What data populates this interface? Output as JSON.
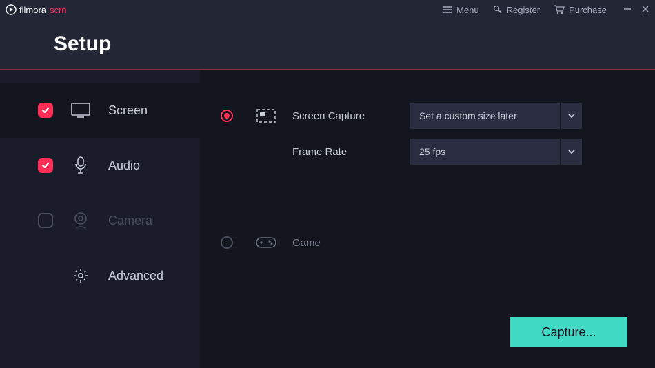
{
  "app": {
    "brand_primary": "filmora",
    "brand_accent": "scrn"
  },
  "titlebar": {
    "menu": "Menu",
    "register": "Register",
    "purchase": "Purchase"
  },
  "header": {
    "title": "Setup"
  },
  "sidebar": {
    "items": [
      {
        "label": "Screen",
        "checked": true,
        "active": true
      },
      {
        "label": "Audio",
        "checked": true
      },
      {
        "label": "Camera",
        "checked": false,
        "disabled": true
      },
      {
        "label": "Advanced"
      }
    ]
  },
  "content": {
    "screen_capture": {
      "label": "Screen Capture",
      "value": "Set a custom size later"
    },
    "frame_rate": {
      "label": "Frame Rate",
      "value": "25 fps"
    },
    "game": {
      "label": "Game"
    },
    "capture_button": "Capture..."
  }
}
